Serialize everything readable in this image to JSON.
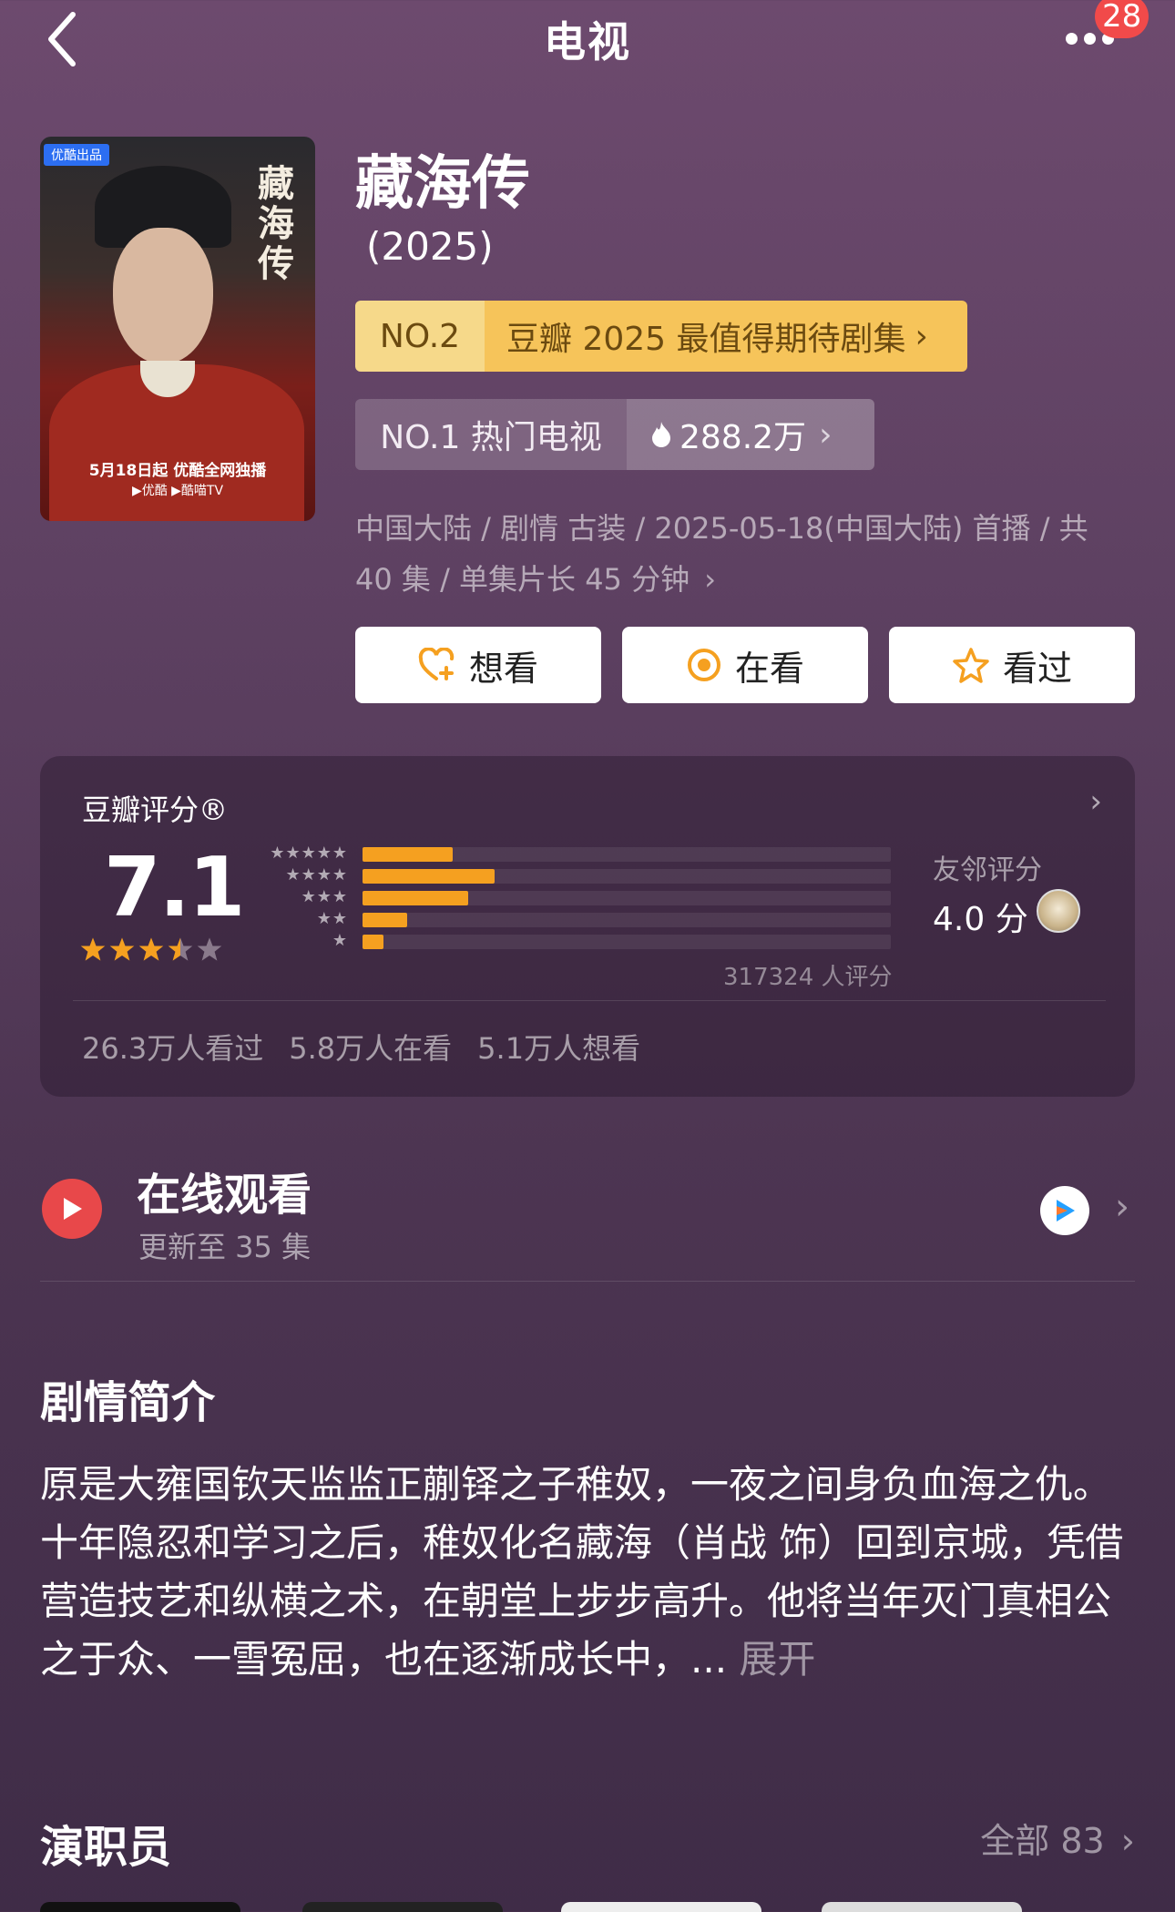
{
  "topbar": {
    "title": "电视",
    "notification_count": "28"
  },
  "poster": {
    "tag": "优酷出品",
    "vertical_title": "藏海传",
    "release_line": "5月18日起 优酷全网独播",
    "platforms": "▶优酷 ▶酷喵TV"
  },
  "show": {
    "title": "藏海传",
    "year": "(2025)",
    "rank_primary": {
      "no": "NO.2",
      "text": "豆瓣 2025 最值得期待剧集"
    },
    "rank_secondary": {
      "no": "NO.1 热门电视",
      "heat": "288.2万"
    },
    "meta": "中国大陆 / 剧情 古装 / 2025-05-18(中国大陆) 首播 / 共 40 集 / 单集片长 45 分钟"
  },
  "actions": [
    {
      "label": "想看",
      "icon": "heart-plus-icon"
    },
    {
      "label": "在看",
      "icon": "target-icon"
    },
    {
      "label": "看过",
      "icon": "star-outline-icon"
    }
  ],
  "rating": {
    "title": "豆瓣评分®",
    "score": "7.1",
    "stars": 3.5,
    "distribution": [
      {
        "stars": "★★★★★",
        "fraction": 0.17
      },
      {
        "stars": "★★★★",
        "fraction": 0.25
      },
      {
        "stars": "★★★",
        "fraction": 0.2
      },
      {
        "stars": "★★",
        "fraction": 0.085
      },
      {
        "stars": "★",
        "fraction": 0.04
      }
    ],
    "count": "317324 人评分",
    "friend_label": "友邻评分",
    "friend_score": "4.0 分",
    "stats": [
      "26.3万人看过",
      "5.8万人在看",
      "5.1万人想看"
    ]
  },
  "online": {
    "title": "在线观看",
    "subtitle": "更新至 35 集"
  },
  "synopsis": {
    "heading": "剧情简介",
    "text": "原是大雍国钦天监监正蒯铎之子稚奴，一夜之间身负血海之仇。十年隐忍和学习之后，稚奴化名藏海（肖战 饰）回到京城，凭借营造技艺和纵横之术，在朝堂上步步高升。他将当年灭门真相公之于众、一雪冤屈，也在逐渐成长中，...",
    "more": "展开"
  },
  "cast": {
    "heading": "演职员",
    "all_label": "全部 83"
  },
  "colors": {
    "accent": "#f5a020",
    "rank_gold": "#f6c45a",
    "play_red": "#e8484a"
  }
}
